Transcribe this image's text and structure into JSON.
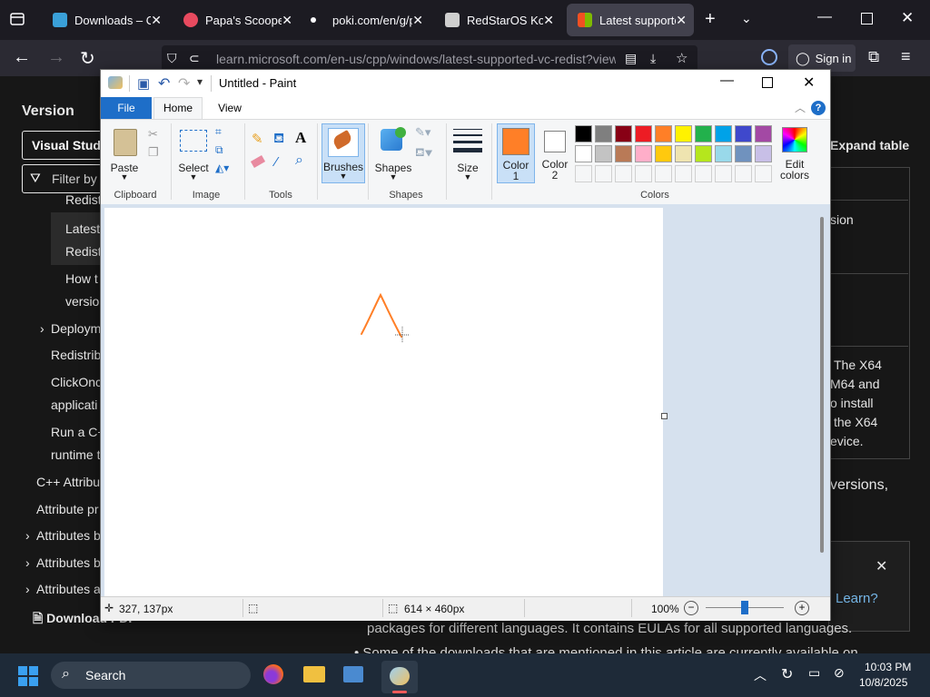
{
  "browser": {
    "tabs": [
      {
        "title": "Downloads – On",
        "fav_color": "#3aa0d8"
      },
      {
        "title": "Papa's Scooperia",
        "fav_color": "#e84a5f"
      },
      {
        "title": "poki.com/en/g/p",
        "fav_color": "#fbfbfe"
      },
      {
        "title": "RedStarOS Korea",
        "fav_color": "#cfcfcf"
      },
      {
        "title": "Latest supported",
        "fav_color": "#f25022"
      }
    ],
    "url": "learn.microsoft.com/en-us/cpp/windows/latest-supported-vc-redist?view",
    "sign_in": "Sign in"
  },
  "page": {
    "version_heading": "Version",
    "version_select": "Visual Studio",
    "filter_placeholder": "Filter by",
    "nav_items": [
      "Redist",
      "Latest",
      "Redist",
      "How t",
      "versio",
      "Deploym",
      "Redistrib",
      "ClickOnc",
      "applicati",
      "Run a C+",
      "runtime t",
      "C++ Attribu",
      "Attribute pr",
      "Attributes b",
      "Attributes b",
      "Attributes a"
    ],
    "download_pdf": "Download PDF",
    "expand_table": "Expand table",
    "table_cells": [
      "sion",
      "The X64",
      "M64 and",
      "o install",
      "the X64",
      "evice."
    ],
    "versions_text": "versions,",
    "learn_text": "Learn?",
    "bottom_line1": "packages for different languages. It contains EULAs for all supported languages.",
    "bottom_line2": "Some of the downloads that are mentioned in this article are currently available on"
  },
  "paint": {
    "title": "Untitled - Paint",
    "menu_file": "File",
    "tab_home": "Home",
    "tab_view": "View",
    "clipboard": {
      "paste": "Paste",
      "group": "Clipboard"
    },
    "image": {
      "select": "Select",
      "group": "Image"
    },
    "tools_group": "Tools",
    "brushes": "Brushes",
    "shapes": {
      "label": "Shapes",
      "group": "Shapes"
    },
    "size": "Size",
    "color1": {
      "label1": "Color",
      "label2": "1",
      "value": "#ff7f27"
    },
    "color2": {
      "label1": "Color",
      "label2": "2",
      "value": "#ffffff"
    },
    "colors_group": "Colors",
    "edit_colors1": "Edit",
    "edit_colors2": "colors",
    "palette_row1": [
      "#000000",
      "#7f7f7f",
      "#880015",
      "#ed1c24",
      "#ff7f27",
      "#fff200",
      "#22b14c",
      "#00a2e8",
      "#3f48cc",
      "#a349a4"
    ],
    "palette_row2": [
      "#ffffff",
      "#c3c3c3",
      "#b97a57",
      "#ffaec9",
      "#ffc90e",
      "#efe4b0",
      "#b5e61d",
      "#99d9ea",
      "#7092be",
      "#c8bfe7"
    ],
    "status": {
      "cursor_pos": "327, 137px",
      "canvas_size": "614 × 460px",
      "zoom": "100%"
    }
  },
  "taskbar": {
    "search": "Search",
    "time": "10:03 PM",
    "date": "10/8/2025"
  }
}
